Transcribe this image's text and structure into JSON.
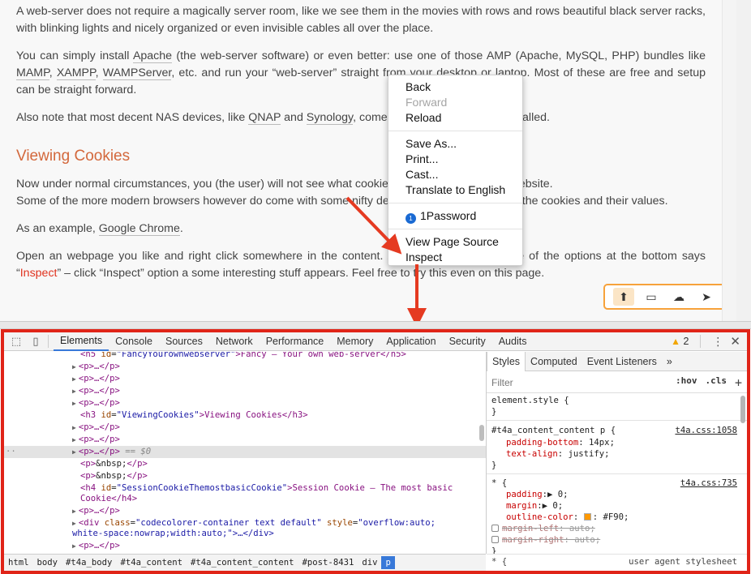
{
  "article": {
    "p1": "A web-server does not require a magically server room, like we see them in the movies with rows and rows beautiful black server racks, with blinking lights and nicely organized or even invisible cables all over the place.",
    "p2_a": "You can simply install ",
    "p2_link_apache": "Apache",
    "p2_b": " (the web-server software) or even better: use one of those AMP (Apache, MySQL, PHP) bundles like ",
    "p2_link_mamp": "MAMP",
    "p2_c": ", ",
    "p2_link_xampp": "XAMPP",
    "p2_d": ", ",
    "p2_link_wamp": "WAMPServer",
    "p2_e": ", etc. and run your “web-server” straight from your desktop or laptop. Most of these are free and setup can be straight forward.",
    "p3_a": "Also note that most decent NAS devices, like ",
    "p3_link_qnap": "QNAP",
    "p3_b": " and ",
    "p3_link_synology": "Synology",
    "p3_c": ", come with a web-server pre-installed.",
    "heading": "Viewing Cookies",
    "p4_line1": "Now under normal circumstances, you (the user) will not see what cookies are being placed by a website.",
    "p4_line2": "Some of the more modern browsers however do come with some nifty developer tools to show you the cookies and their values.",
    "p5_a": "As an example, ",
    "p5_link_chrome": "Google Chrome",
    "p5_b": ".",
    "p6_a": "Open an webpage you like and right click somewhere in the content. A menu pops up and one of the options at the bottom says “",
    "p6_red": "Inspect",
    "p6_b": "” – click “Inspect” option a some interesting stuff appears. Feel free to try this even on this page."
  },
  "social": {
    "icons": [
      "arrow-up-circle-icon",
      "monitor-icon",
      "chat-bubbles-icon",
      "paper-plane-icon"
    ],
    "glyphs": [
      "⬆",
      "▭",
      "☁",
      "➤"
    ],
    "accent": "#f7a23b"
  },
  "context_menu": {
    "back": "Back",
    "forward": "Forward",
    "reload": "Reload",
    "save_as": "Save As...",
    "print": "Print...",
    "cast": "Cast...",
    "translate": "Translate to English",
    "onepassword": "1Password",
    "onepassword_glyph": "1",
    "view_source": "View Page Source",
    "inspect": "Inspect"
  },
  "devtools": {
    "accent_frame": "#e02418",
    "tabs": [
      "Elements",
      "Console",
      "Sources",
      "Network",
      "Performance",
      "Memory",
      "Application",
      "Security",
      "Audits"
    ],
    "active_tab": "Elements",
    "warning_count": "2",
    "dom": {
      "l0_tag_open": "<h5 ",
      "l0_attr": "id",
      "l0_val": "\"FancyYourownwebserver\"",
      "l0_text": ">Fancy – Your own web-server</h5>",
      "p_collapsed": "<p>…</p>",
      "l5_tag": "<h3 ",
      "l5_attr": "id",
      "l5_val": "\"ViewingCookies\"",
      "l5_text": ">Viewing Cookies</h3>",
      "sel_suffix": " == $0",
      "sel_dots": "··",
      "nbsp_open": "<p>",
      "nbsp_text": "&nbsp;",
      "nbsp_close": "</p>",
      "h4_tag": "<h4 ",
      "h4_attr": "id",
      "h4_val": "\"SessionCookieThemostbasicCookie\"",
      "h4_text": ">Session Cookie – The most basic",
      "h4_cont": "Cookie</h4>",
      "div_tag": "<div ",
      "div_class_attr": "class",
      "div_class_val": "\"codecolorer-container text default\"",
      "div_style_attr": "style",
      "div_style_val": "\"overflow:auto;",
      "div_cont": "white-space:nowrap;width:auto;\">…</div>"
    },
    "styles": {
      "tabs": [
        "Styles",
        "Computed",
        "Event Listeners"
      ],
      "more": "»",
      "filter_placeholder": "Filter",
      "hov": ":hov",
      "cls": ".cls",
      "plus": "+",
      "element_style": "element.style {",
      "close_brace": "}",
      "rule1_selector": "#t4a_content_content p {",
      "rule1_source": "t4a.css:1058",
      "rule1_p1_name": "padding-bottom",
      "rule1_p1_val": ": 14px;",
      "rule1_p2_name": "text-align",
      "rule1_p2_val": ": justify;",
      "rule2_selector": "* {",
      "rule2_source": "t4a.css:735",
      "rule2_p1_name": "padding",
      "rule2_p1_val": ":▶ 0;",
      "rule2_p2_name": "margin",
      "rule2_p2_val": ":▶ 0;",
      "rule2_p3_name": "outline-color",
      "rule2_p3_val": ": #F90;",
      "rule2_p4_name": "margin-left",
      "rule2_p4_val": ": auto;",
      "rule2_p5_name": "margin-right",
      "rule2_p5_val": ": auto;",
      "swatch_color": "#ff9900",
      "bottom_text": "* {",
      "bottom_source": "user agent stylesheet"
    },
    "breadcrumbs": [
      "html",
      "body",
      "#t4a_body",
      "#t4a_content",
      "#t4a_content_content",
      "#post-8431",
      "div",
      "p"
    ]
  }
}
